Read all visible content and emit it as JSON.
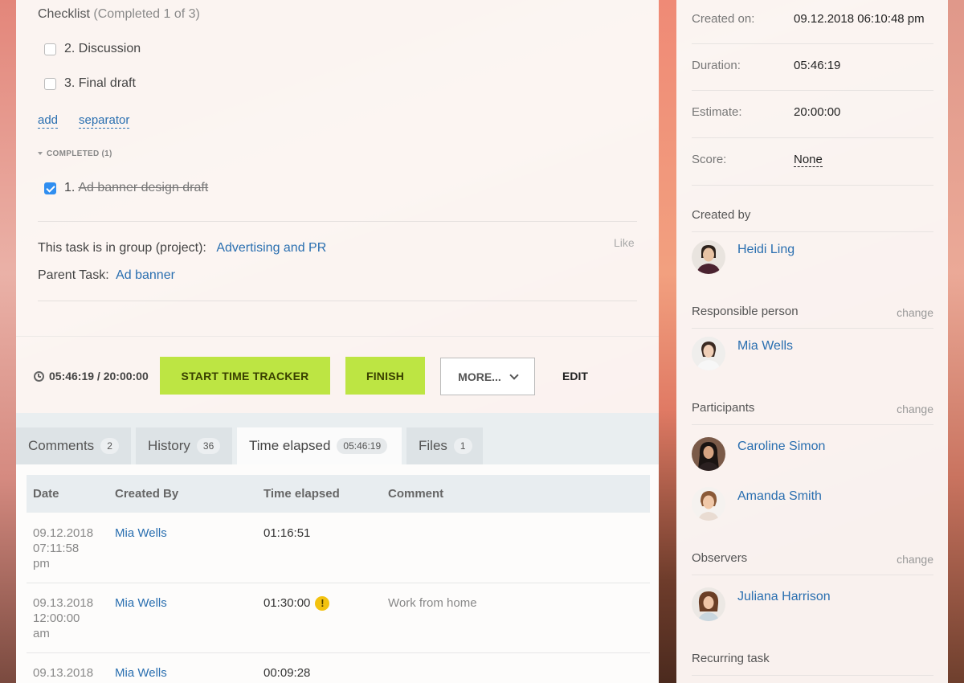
{
  "checklist": {
    "title": "Checklist",
    "subtitle": "(Completed 1 of 3)",
    "items": [
      {
        "label": "2. Discussion",
        "checked": false
      },
      {
        "label": "3. Final draft",
        "checked": false
      }
    ],
    "add_label": "add",
    "separator_label": "separator",
    "completed_header": "COMPLETED (1)",
    "completed_items": [
      {
        "number": "1.",
        "label": "Ad banner design draft",
        "checked": true
      }
    ]
  },
  "task_info": {
    "group_label": "This task is in group (project):",
    "group_value": "Advertising and PR",
    "parent_label": "Parent Task:",
    "parent_value": "Ad banner",
    "like_label": "Like"
  },
  "actions": {
    "timer": "05:46:19 / 20:00:00",
    "start_tracker": "START TIME TRACKER",
    "finish": "FINISH",
    "more": "MORE...",
    "edit": "EDIT"
  },
  "tabs": [
    {
      "label": "Comments",
      "count": "2"
    },
    {
      "label": "History",
      "count": "36"
    },
    {
      "label": "Time elapsed",
      "count": "05:46:19"
    },
    {
      "label": "Files",
      "count": "1"
    }
  ],
  "time_table": {
    "headers": [
      "Date",
      "Created By",
      "Time elapsed",
      "Comment"
    ],
    "rows": [
      {
        "date": [
          "09.12.2018",
          "07:11:58",
          "pm"
        ],
        "created_by": "Mia Wells",
        "elapsed": "01:16:51",
        "warn": false,
        "comment": ""
      },
      {
        "date": [
          "09.13.2018",
          "12:00:00",
          "am"
        ],
        "created_by": "Mia Wells",
        "elapsed": "01:30:00",
        "warn": true,
        "warn_glyph": "!",
        "comment": "Work from home"
      },
      {
        "date": [
          "09.13.2018",
          "",
          ""
        ],
        "created_by": "Mia Wells",
        "elapsed": "00:09:28",
        "warn": false,
        "comment": ""
      }
    ]
  },
  "sidebar": {
    "fields": [
      {
        "label": "Created on:",
        "value": "09.12.2018 06:10:48 pm"
      },
      {
        "label": "Duration:",
        "value": "05:46:19"
      },
      {
        "label": "Estimate:",
        "value": "20:00:00"
      },
      {
        "label": "Score:",
        "value": "None"
      }
    ],
    "created_by": {
      "title": "Created by",
      "people": [
        "Heidi Ling"
      ]
    },
    "responsible": {
      "title": "Responsible person",
      "change": "change",
      "people": [
        "Mia Wells"
      ]
    },
    "participants": {
      "title": "Participants",
      "change": "change",
      "people": [
        "Caroline Simon",
        "Amanda Smith"
      ]
    },
    "observers": {
      "title": "Observers",
      "change": "change",
      "people": [
        "Juliana Harrison"
      ]
    },
    "recurring": {
      "title": "Recurring task"
    }
  },
  "colors": {
    "accent_green": "#bde543",
    "link_blue": "#2a6fb0",
    "checkbox_blue": "#2f8ef0",
    "warning_yellow": "#f3c20f"
  },
  "icons": [
    "checkbox-icon",
    "checkbox-checked-icon",
    "triangle-down-icon",
    "clock-icon",
    "chevron-down-icon",
    "warning-icon"
  ]
}
